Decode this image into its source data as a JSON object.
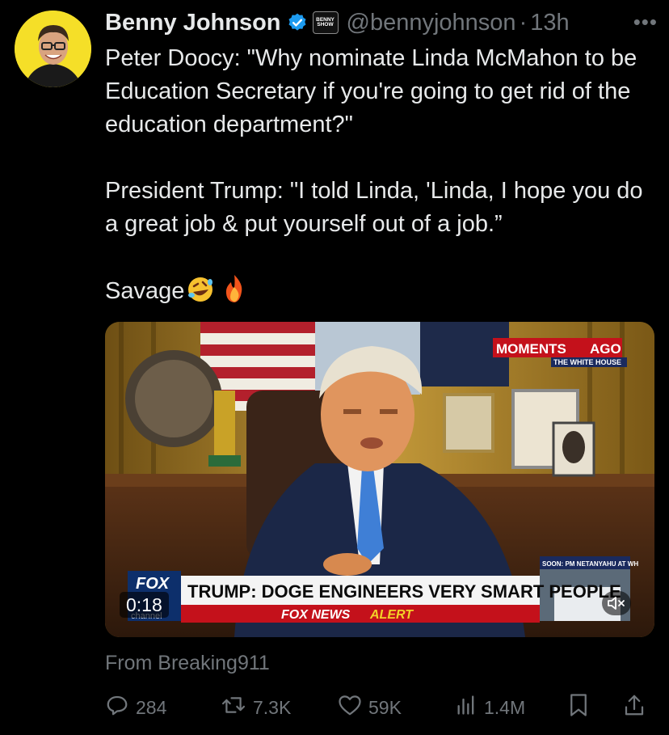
{
  "author": {
    "name": "Benny Johnson",
    "handle": "@bennyjohnson",
    "separator": "·",
    "time": "13h",
    "affiliate_badge": [
      "BENNY",
      "SHOW"
    ]
  },
  "tweet": {
    "line1": "Peter Doocy: \"Why nominate Linda McMahon to be Education Secretary if you're going to get rid of the education department?\"",
    "line2": "President Trump: \"I told Linda, 'Linda, I hope you do a great job & put yourself out of a job.”",
    "line3": "Savage",
    "emojis": [
      "rolling-on-floor-laughing",
      "fire"
    ]
  },
  "media": {
    "duration": "0:18",
    "overlay": {
      "moments": "MOMENTS",
      "ago": "AGO",
      "location": "THE WHITE HOUSE",
      "headline": "TRUMP: DOGE ENGINEERS VERY SMART PEOPLE",
      "alert_fox": "FOX NEWS",
      "alert_word": "ALERT",
      "soon": "SOON: PM NETANYAHU AT WH",
      "logo_top": "FOX",
      "logo_sub": "channel"
    }
  },
  "source": "From Breaking911",
  "actions": {
    "replies": "284",
    "reposts": "7.3K",
    "likes": "59K",
    "views": "1.4M"
  },
  "colors": {
    "background": "#000000",
    "text": "#e7e9ea",
    "muted": "#71767b",
    "verified": "#1d9bf0"
  }
}
